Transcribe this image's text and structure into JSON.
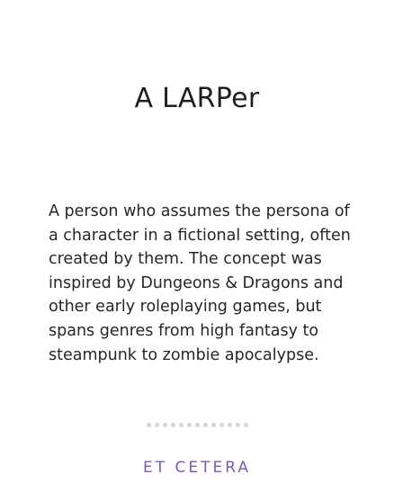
{
  "card": {
    "title": "A LARPer",
    "definition": "A person who assumes the persona of a character in a fictional setting, often created by them. The concept was inspired by Dungeons & Dragons and other early roleplaying games, but spans genres from high fantasy to steampunk to zombie apocalypse.",
    "footer_label": "ET CETERA",
    "footer_color": "#7b5bb6",
    "dot_count": 13
  }
}
